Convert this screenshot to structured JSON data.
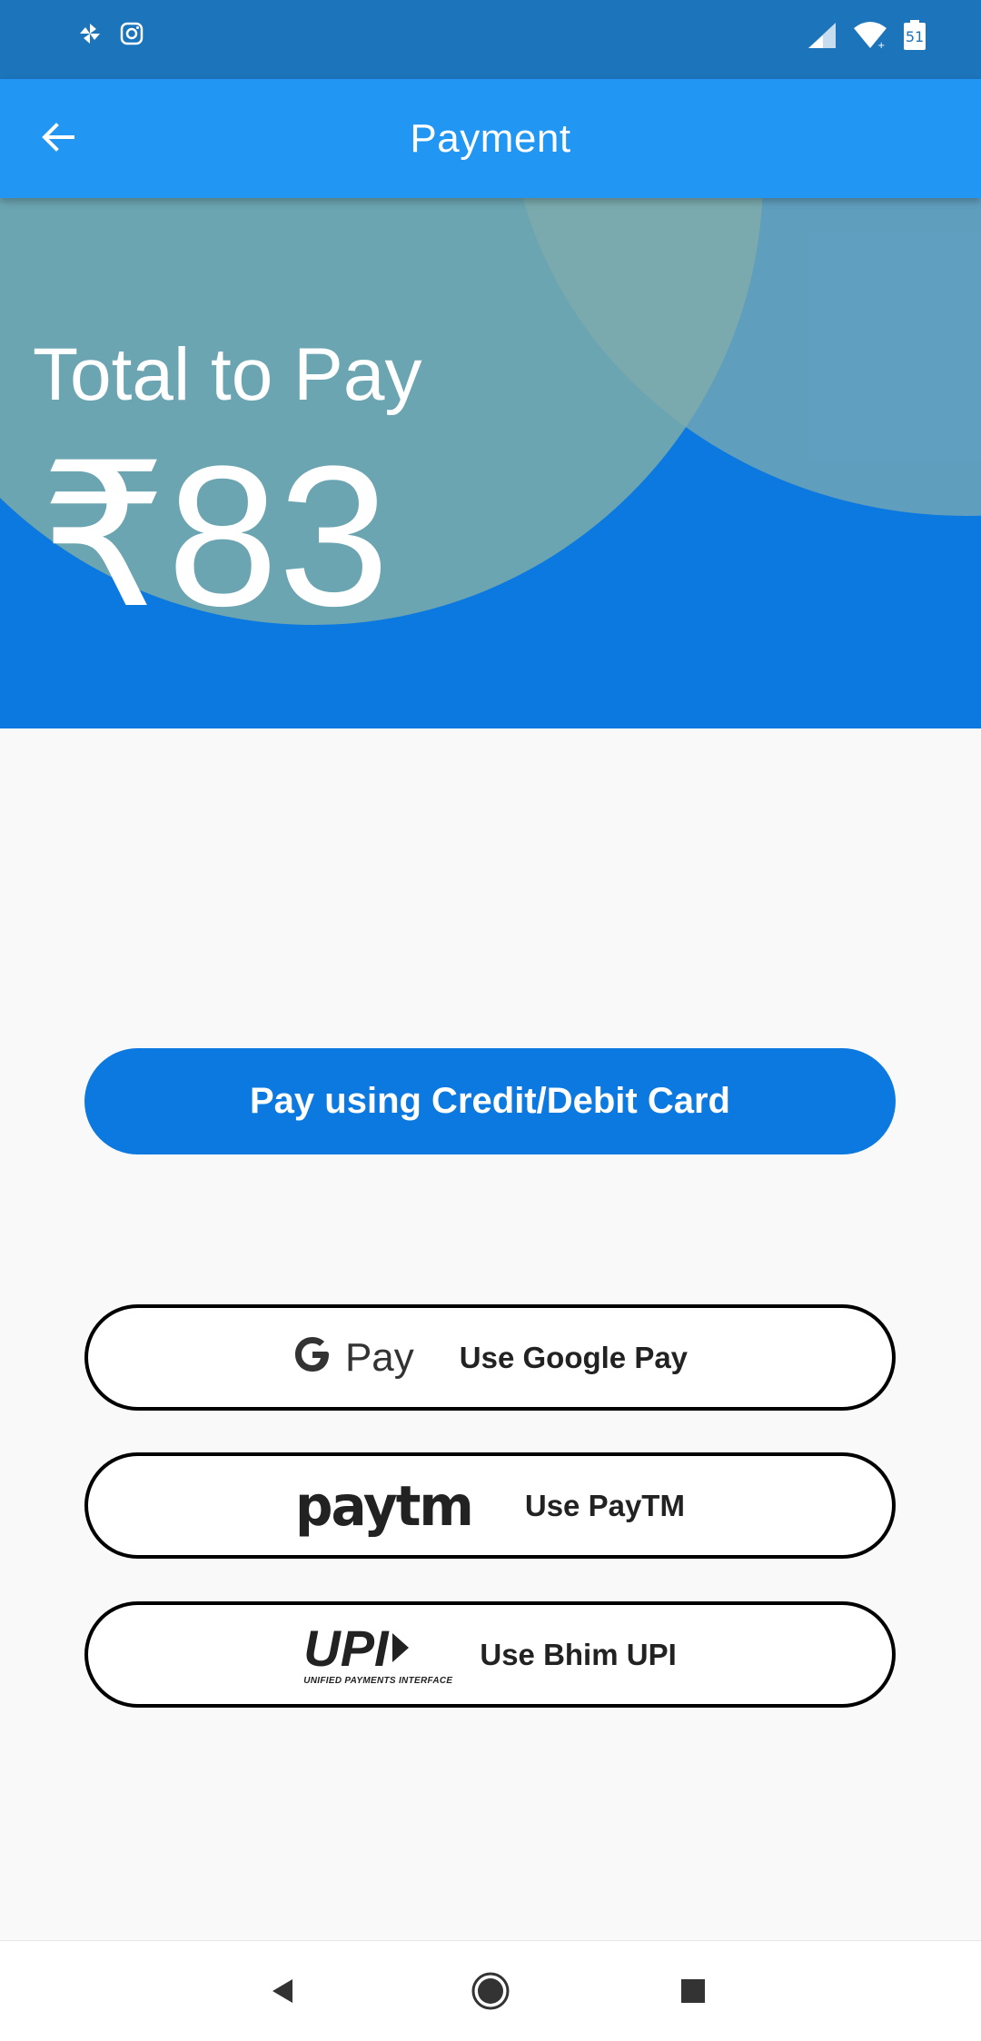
{
  "status_bar": {
    "left_icons": [
      "pinwheel-icon",
      "instagram-icon"
    ],
    "right_icons": [
      "signal-icon",
      "wifi-icon",
      "battery-icon"
    ],
    "battery_level": "51"
  },
  "app_bar": {
    "title": "Payment",
    "back_icon": "arrow-back-icon"
  },
  "hero": {
    "label": "Total to Pay",
    "amount": "₹83",
    "background_color": "#0c79e0"
  },
  "actions": {
    "card_button": "Pay using Credit/Debit Card",
    "gpay": {
      "logo_text": "Pay",
      "label": "Use Google Pay"
    },
    "paytm": {
      "logo_text": "paytm",
      "label": "Use PayTM"
    },
    "upi": {
      "logo_text": "UPI",
      "logo_subtext": "UNIFIED PAYMENTS INTERFACE",
      "label": "Use Bhim UPI"
    }
  },
  "nav_bar": {
    "buttons": [
      "back-triangle-icon",
      "home-circle-icon",
      "recents-square-icon"
    ]
  },
  "colors": {
    "status_bar": "#1c74bb",
    "app_bar": "#2196f3",
    "primary": "#0c79e0"
  }
}
